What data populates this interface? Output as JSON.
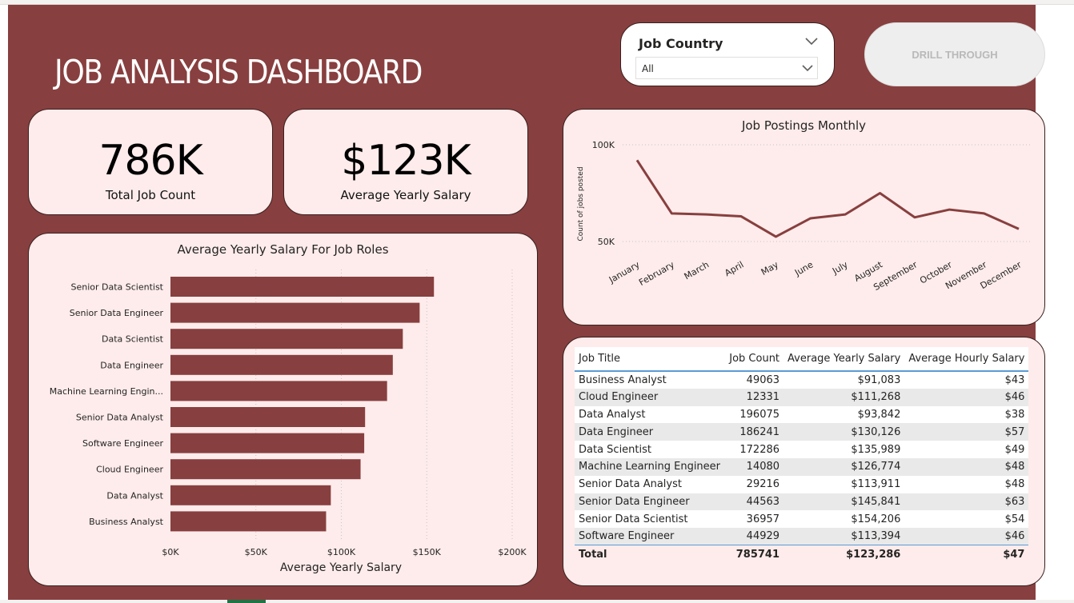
{
  "dashboard": {
    "title": "JOB ANALYSIS DASHBOARD",
    "slicer": {
      "title": "Job Country",
      "selected": "All"
    },
    "drill_button": "DRILL THROUGH",
    "colors": {
      "background": "#883f3f",
      "card": "#fdeceb",
      "accent": "#883f3f",
      "table_rule": "#5b9bd5"
    }
  },
  "kpis": [
    {
      "value": "786K",
      "label": "Total Job Count"
    },
    {
      "value": "$123K",
      "label": "Average Yearly Salary"
    }
  ],
  "chart_data": [
    {
      "type": "bar",
      "orientation": "horizontal",
      "title": "Average Yearly Salary For Job Roles",
      "xlabel": "Average Yearly Salary",
      "ylabel": "",
      "categories": [
        "Senior Data Scientist",
        "Senior Data Engineer",
        "Data Scientist",
        "Data Engineer",
        "Machine Learning Engin...",
        "Senior Data Analyst",
        "Software Engineer",
        "Cloud Engineer",
        "Data Analyst",
        "Business Analyst"
      ],
      "values": [
        154206,
        145841,
        135989,
        130126,
        126774,
        113911,
        113394,
        111268,
        93842,
        91083
      ],
      "xlim": [
        0,
        200000
      ],
      "xticks": [
        "$0K",
        "$50K",
        "$100K",
        "$150K",
        "$200K"
      ],
      "xtick_values": [
        0,
        50000,
        100000,
        150000,
        200000
      ],
      "grid": true,
      "color": "#883f3f"
    },
    {
      "type": "line",
      "title": "Job Postings Monthly",
      "xlabel": "",
      "ylabel": "Count of jobs posted",
      "x": [
        "January",
        "February",
        "March",
        "April",
        "May",
        "June",
        "July",
        "August",
        "September",
        "October",
        "November",
        "December"
      ],
      "values": [
        92000,
        64500,
        64000,
        63000,
        52500,
        62000,
        64000,
        75000,
        62500,
        66500,
        64500,
        56500
      ],
      "ylim": [
        50000,
        100000
      ],
      "yticks": [
        "50K",
        "100K"
      ],
      "ytick_values": [
        50000,
        100000
      ],
      "grid": true,
      "color": "#883f3f"
    }
  ],
  "table": {
    "headers": [
      "Job Title",
      "Job Count",
      "Average Yearly Salary",
      "Average Hourly Salary"
    ],
    "rows": [
      [
        "Business Analyst",
        "49063",
        "$91,083",
        "$43"
      ],
      [
        "Cloud Engineer",
        "12331",
        "$111,268",
        "$46"
      ],
      [
        "Data Analyst",
        "196075",
        "$93,842",
        "$38"
      ],
      [
        "Data Engineer",
        "186241",
        "$130,126",
        "$57"
      ],
      [
        "Data Scientist",
        "172286",
        "$135,989",
        "$49"
      ],
      [
        "Machine Learning Engineer",
        "14080",
        "$126,774",
        "$48"
      ],
      [
        "Senior Data Analyst",
        "29216",
        "$113,911",
        "$48"
      ],
      [
        "Senior Data Engineer",
        "44563",
        "$145,841",
        "$63"
      ],
      [
        "Senior Data Scientist",
        "36957",
        "$154,206",
        "$54"
      ],
      [
        "Software Engineer",
        "44929",
        "$113,394",
        "$46"
      ]
    ],
    "total": [
      "Total",
      "785741",
      "$123,286",
      "$47"
    ]
  }
}
